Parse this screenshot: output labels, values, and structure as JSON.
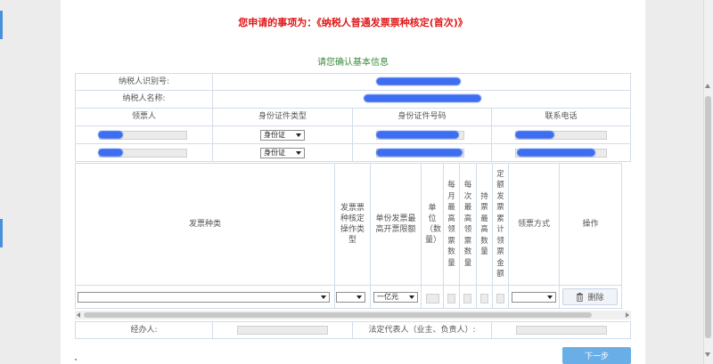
{
  "apply_title": "您申请的事项为：《纳税人普通发票票种核定(首次)》",
  "section_title": "请您确认基本信息",
  "taxpayer": {
    "id_label": "纳税人识别号:",
    "name_label": "纳税人名称:"
  },
  "receiver_header": {
    "receiver": "领票人",
    "id_type": "身份证件类型",
    "id_number": "身份证件号码",
    "phone": "联系电话"
  },
  "receivers": [
    {
      "id_type": "身份证"
    },
    {
      "id_type": "身份证"
    }
  ],
  "invoice_header": {
    "type": "发票种类",
    "approve_op": "发票票种核定操作类型",
    "max_limit": "单份发票最高开票限额",
    "unit": "单位（数量）",
    "monthly_max": "每月最高领票数量",
    "per_max": "每次最高领票数量",
    "hold_max": "持票最高数量",
    "quota_total": "定额发票累计领票金额",
    "method": "领票方式",
    "action": "操作"
  },
  "invoice_row": {
    "type_value": "",
    "op_value": "",
    "limit_value": "一亿元",
    "method_value": "",
    "delete_label": "删除"
  },
  "footer": {
    "handler_label": "经办人:",
    "legal_label": "法定代表人（业主、负责人）:",
    "next_label": "下一步"
  },
  "colors": {
    "title_red": "#e01818",
    "section_green": "#3a8a3a",
    "redaction_blue": "#3d6df0",
    "next_button": "#6aaee8"
  }
}
